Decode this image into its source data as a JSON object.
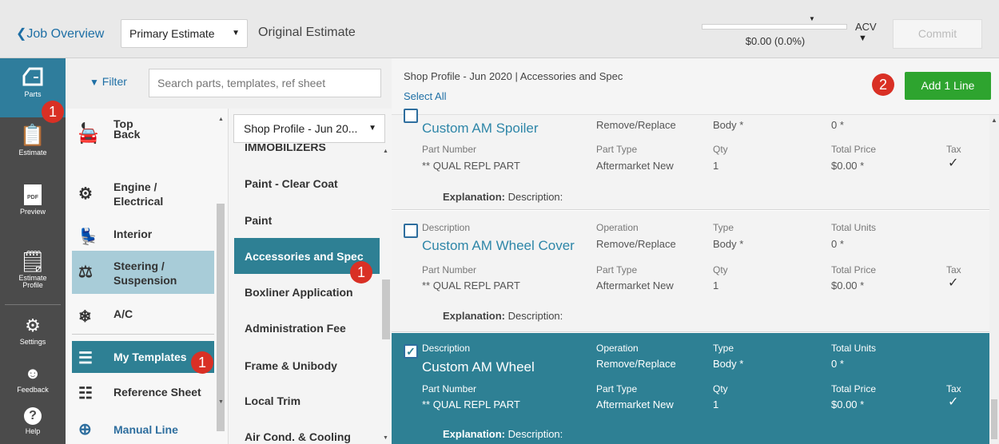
{
  "header": {
    "back_label": "❮Job Overview",
    "estimate_select": "Primary Estimate",
    "original_estimate": "Original Estimate",
    "progress_text": "$0.00 (0.0%)",
    "progress_fraction": 0.0,
    "acv_label": "ACV",
    "commit_label": "Commit"
  },
  "rail": {
    "parts": "Parts",
    "estimate": "Estimate",
    "preview": "Preview",
    "pdf_tag": "PDF",
    "estimate_profile_1": "Estimate",
    "estimate_profile_2": "Profile",
    "settings": "Settings",
    "feedback": "Feedback",
    "help": "Help"
  },
  "filter": {
    "filter_label": "Filter",
    "search_placeholder": "Search parts, templates, ref sheet"
  },
  "categories": [
    {
      "label": "Top",
      "icon": "roof-icon"
    },
    {
      "label": "Back",
      "icon": "car-back-icon"
    },
    {
      "label": "Engine / Electrical",
      "icon": "engine-icon"
    },
    {
      "label": "Interior",
      "icon": "seat-icon"
    },
    {
      "label": "Steering / Suspension",
      "icon": "suspension-icon"
    },
    {
      "label": "A/C",
      "icon": "ac-icon"
    },
    {
      "label": "My Templates",
      "icon": "templates-icon"
    },
    {
      "label": "Reference Sheet",
      "icon": "reference-sheet-icon"
    },
    {
      "label": "Manual Line",
      "icon": "plus-circle-icon"
    }
  ],
  "subcategories": {
    "profile_select": "Shop Profile - Jun 20...",
    "items": [
      "Immobilizers",
      "Paint - Clear Coat",
      "Paint",
      "Accessories and Spec",
      "Boxliner Application",
      "Administration Fee",
      "Frame & Unibody",
      "Local Trim",
      "Air Cond. & Cooling"
    ]
  },
  "badges": {
    "one": "1",
    "two": "2"
  },
  "main": {
    "title": "Shop Profile - Jun 2020 | Accessories and Spec",
    "select_all": "Select All",
    "add_button": "Add 1 Line",
    "labels": {
      "description": "Description",
      "operation": "Operation",
      "type": "Type",
      "total_units": "Total Units",
      "part_number": "Part Number",
      "part_type": "Part Type",
      "qty": "Qty",
      "total_price": "Total Price",
      "tax": "Tax",
      "explanation": "Explanation:"
    },
    "rows": [
      {
        "title": "Custom AM Spoiler",
        "operation": "Remove/Replace",
        "type": "Body *",
        "units": "0 *",
        "part_number": "** QUAL REPL PART",
        "part_type": "Aftermarket New",
        "qty": "1",
        "price": "$0.00 *",
        "tax": "✓",
        "explanation": "Description:"
      },
      {
        "title": "Custom AM Wheel Cover",
        "operation": "Remove/Replace",
        "type": "Body *",
        "units": "0 *",
        "part_number": "** QUAL REPL PART",
        "part_type": "Aftermarket New",
        "qty": "1",
        "price": "$0.00 *",
        "tax": "✓",
        "explanation": "Description:"
      },
      {
        "title": "Custom AM Wheel",
        "operation": "Remove/Replace",
        "type": "Body *",
        "units": "0 *",
        "part_number": "** QUAL REPL PART",
        "part_type": "Aftermarket New",
        "qty": "1",
        "price": "$0.00 *",
        "tax": "✓",
        "explanation": "Description:"
      }
    ]
  }
}
